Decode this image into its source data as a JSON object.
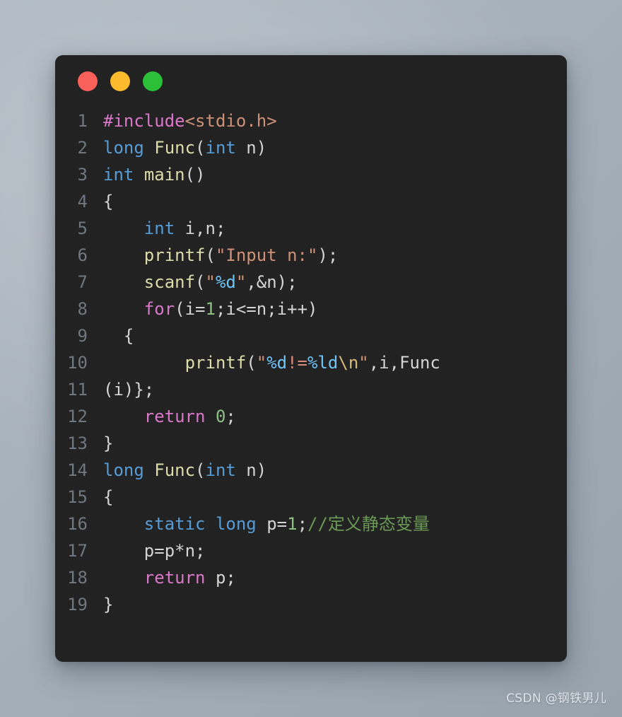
{
  "window": {
    "traffic_lights": [
      {
        "name": "close",
        "color": "#f9615a"
      },
      {
        "name": "minimize",
        "color": "#fcbb2c"
      },
      {
        "name": "maximize",
        "color": "#2cc038"
      }
    ]
  },
  "editor": {
    "language": "c",
    "background": "#222222",
    "line_number_color": "#6f7781",
    "default_text_color": "#d4d4d4",
    "line_numbers": [
      "1",
      "2",
      "3",
      "4",
      "5",
      "6",
      "7",
      "8",
      "9",
      "10",
      "11",
      "12",
      "13",
      "14",
      "15",
      "16",
      "17",
      "18",
      "19"
    ],
    "lines": [
      {
        "number": "1",
        "text": "#include<stdio.h>"
      },
      {
        "number": "2",
        "text": "long Func(int n)"
      },
      {
        "number": "3",
        "text": "int main()"
      },
      {
        "number": "4",
        "text": "{"
      },
      {
        "number": "5",
        "text": "    int i,n;"
      },
      {
        "number": "6",
        "text": "    printf(\"Input n:\");"
      },
      {
        "number": "7",
        "text": "    scanf(\"%d\",&n);"
      },
      {
        "number": "8",
        "text": "    for(i=1;i<=n;i++)"
      },
      {
        "number": "9",
        "text": "  {"
      },
      {
        "number": "10",
        "text": "        printf(\"%d!=%ld\\n\",i,Func"
      },
      {
        "number": "11",
        "text": "(i)};"
      },
      {
        "number": "12",
        "text": "    return 0;"
      },
      {
        "number": "13",
        "text": "}"
      },
      {
        "number": "14",
        "text": "long Func(int n)"
      },
      {
        "number": "15",
        "text": "{"
      },
      {
        "number": "16",
        "text": "    static long p=1;//定义静态变量"
      },
      {
        "number": "17",
        "text": "    p=p*n;"
      },
      {
        "number": "18",
        "text": "    return p;"
      },
      {
        "number": "19",
        "text": "}"
      }
    ],
    "tokens": {
      "l1": {
        "a": "#include",
        "b": "<stdio.h>"
      },
      "l2": {
        "a": "long",
        "b": " ",
        "c": "Func",
        "d": "(",
        "e": "int",
        "f": " n)"
      },
      "l3": {
        "a": "int",
        "b": " ",
        "c": "main",
        "d": "()"
      },
      "l4": {
        "a": "{"
      },
      "l5": {
        "indent": "    ",
        "a": "int",
        "b": " i,n;"
      },
      "l6": {
        "indent": "    ",
        "a": "printf",
        "b": "(",
        "c": "\"Input n:\"",
        "d": ");"
      },
      "l7": {
        "indent": "    ",
        "a": "scanf",
        "b": "(",
        "c": "\"",
        "d": "%d",
        "e": "\"",
        "f": ",&n);"
      },
      "l8": {
        "indent": "    ",
        "a": "for",
        "b": "(i=",
        "c": "1",
        "d": ";i<=n;i++)"
      },
      "l9": {
        "indent": "  ",
        "a": "{"
      },
      "l10": {
        "indent": "        ",
        "a": "printf",
        "b": "(",
        "c": "\"",
        "d": "%d",
        "e": "!=",
        "f": "%ld",
        "g": "\\n",
        "h": "\"",
        "i": ",i,Func"
      },
      "l11": {
        "a": "(i)};"
      },
      "l12": {
        "indent": "    ",
        "a": "return",
        "b": " ",
        "c": "0",
        "d": ";"
      },
      "l13": {
        "a": "}"
      },
      "l14": {
        "a": "long",
        "b": " ",
        "c": "Func",
        "d": "(",
        "e": "int",
        "f": " n)"
      },
      "l15": {
        "a": "{"
      },
      "l16": {
        "indent": "    ",
        "a": "static",
        "b": " ",
        "c": "long",
        "d": " p=",
        "e": "1",
        "f": ";",
        "g": "//定义静态变量"
      },
      "l17": {
        "indent": "    ",
        "a": "p=p*n;"
      },
      "l18": {
        "indent": "    ",
        "a": "return",
        "b": " p;"
      },
      "l19": {
        "a": "}"
      }
    }
  },
  "watermark": {
    "text": "CSDN @钢铁男儿"
  }
}
